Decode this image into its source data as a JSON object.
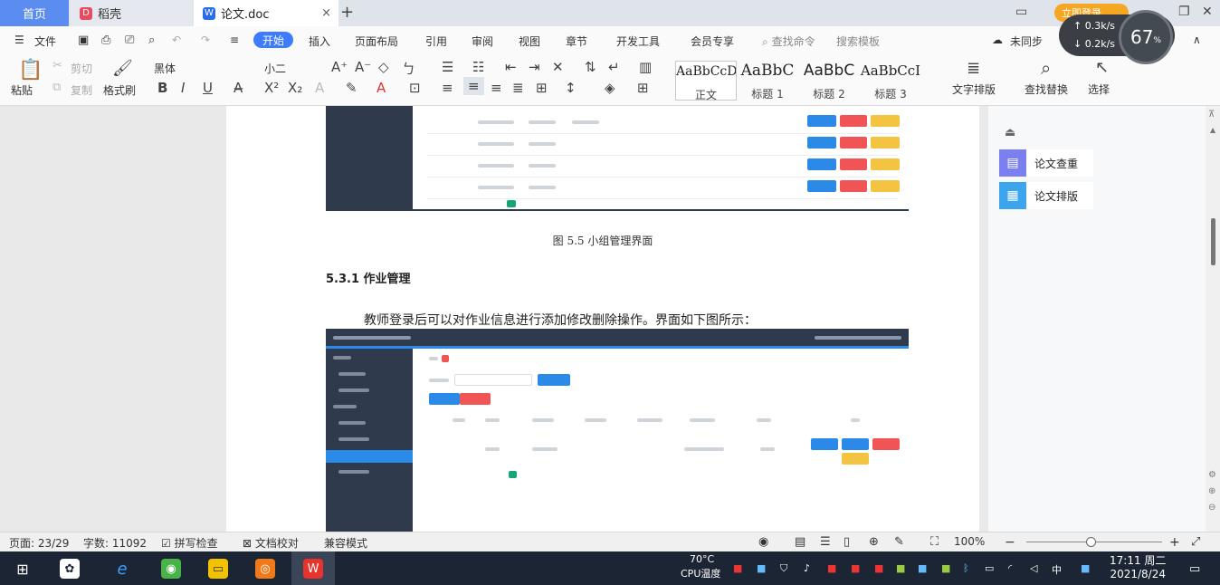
{
  "tabs": {
    "home": "首页",
    "daoke": "稻壳",
    "doc": "论文.doc",
    "close": "×",
    "new": "+",
    "login": "立即登录"
  },
  "menu": {
    "file": "文件",
    "items": [
      "开始",
      "插入",
      "页面布局",
      "引用",
      "审阅",
      "视图",
      "章节",
      "开发工具",
      "会员专享"
    ],
    "search_cmd": "查找命令",
    "search_tpl": "搜索模板",
    "sync": "未同步"
  },
  "ribbon": {
    "paste": "粘贴",
    "cut": "剪切",
    "copy": "复制",
    "format_painter": "格式刷",
    "font_name": "黑体",
    "font_size": "小二",
    "styles": [
      {
        "sample": "AaBbCcDd",
        "name": "正文"
      },
      {
        "sample": "AaBbC",
        "name": "标题 1"
      },
      {
        "sample": "AaBbC",
        "name": "标题 2"
      },
      {
        "sample": "AaBbCcI",
        "name": "标题 3"
      }
    ],
    "text_layout": "文字排版",
    "find_replace": "查找替换",
    "select": "选择"
  },
  "document": {
    "caption": "图 5.5  小组管理界面",
    "heading": "5.3.1  作业管理",
    "paragraph": "教师登录后可以对作业信息进行添加修改删除操作。界面如下图所示："
  },
  "right_pane": {
    "check": "论文查重",
    "layout": "论文排版"
  },
  "status": {
    "page": "页面: 23/29",
    "words": "字数: 11092",
    "spell": "拼写检查",
    "proof": "文档校对",
    "compat": "兼容模式",
    "zoom": "100%"
  },
  "perf": {
    "percent": "67",
    "up": "0.3k/s",
    "down": "0.2k/s"
  },
  "taskbar": {
    "temp": "70°C",
    "cpu": "CPU温度",
    "time": "17:11 周二",
    "date": "2021/8/24"
  },
  "colors": {
    "accent": "#3d7bff",
    "btn_blue": "#2b89e8",
    "btn_red": "#f05454",
    "btn_yellow": "#f5c342",
    "app_dark": "#2f3b4c"
  }
}
